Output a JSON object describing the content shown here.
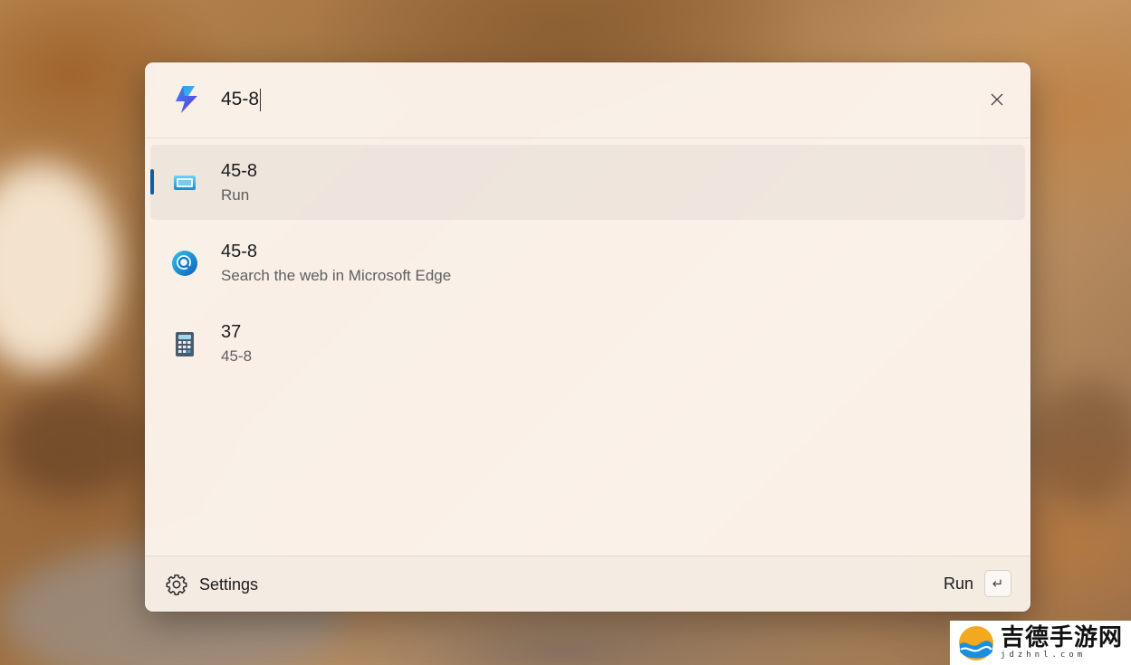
{
  "search": {
    "query": "45-8"
  },
  "results": [
    {
      "title": "45-8",
      "subtitle": "Run",
      "icon": "run-icon",
      "selected": true
    },
    {
      "title": "45-8",
      "subtitle": "Search the web in Microsoft Edge",
      "icon": "edge-search-icon",
      "selected": false
    },
    {
      "title": "37",
      "subtitle": "45-8",
      "icon": "calculator-icon",
      "selected": false
    }
  ],
  "footer": {
    "settings_label": "Settings",
    "action_label": "Run",
    "enter_key_glyph": "↵"
  },
  "watermark": {
    "cn_text": "吉德手游网",
    "url_text": "jdzhnl.com"
  },
  "colors": {
    "accent": "#0d5ea8",
    "panel_background": "#fcf4ec"
  }
}
